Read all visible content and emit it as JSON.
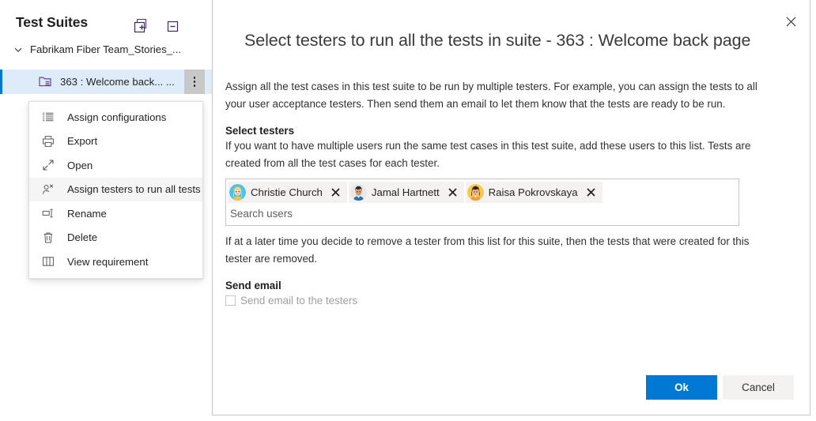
{
  "suites_panel": {
    "title": "Test Suites",
    "expand_all_icon": "expand-all-icon",
    "collapse_all_icon": "collapse-all-icon",
    "tree": [
      {
        "label": "Fabrikam Fiber Team_Stories_...",
        "icon": "chevron-down-icon",
        "level": 0,
        "selected": false
      },
      {
        "label": "363 : Welcome back... ...",
        "icon": "test-suite-folder-icon",
        "level": 1,
        "selected": true
      }
    ],
    "more_actions_icon": "more-actions-vertical-icon"
  },
  "context_menu": {
    "items": [
      {
        "label": "Assign configurations",
        "icon": "list-settings-icon",
        "hovered": false
      },
      {
        "label": "Export",
        "icon": "printer-icon",
        "hovered": false
      },
      {
        "label": "Open",
        "icon": "open-expand-icon",
        "hovered": false
      },
      {
        "label": "Assign testers to run all tests",
        "icon": "assign-user-icon",
        "hovered": true
      },
      {
        "label": "Rename",
        "icon": "rename-icon",
        "hovered": false
      },
      {
        "label": "Delete",
        "icon": "trash-icon",
        "hovered": false
      },
      {
        "label": "View requirement",
        "icon": "book-requirement-icon",
        "hovered": false
      }
    ]
  },
  "dialog": {
    "title": "Select testers to run all the tests in suite - 363 : Welcome back page",
    "close_icon": "close-icon",
    "intro_paragraph": "Assign all the test cases in this test suite to be run by multiple testers. For example, you can assign the tests to all your user acceptance testers. Then send them an email to let them know that the tests are ready to be run.",
    "select_testers": {
      "heading": "Select testers",
      "description": "If you want to have multiple users run the same test cases in this test suite, add these users to this list. Tests are created from all the test cases for each tester.",
      "chips": [
        {
          "name": "Christie Church",
          "avatar": "avatar-christie-church",
          "remove_icon": "remove-chip-icon"
        },
        {
          "name": "Jamal Hartnett",
          "avatar": "avatar-jamal-hartnett",
          "remove_icon": "remove-chip-icon"
        },
        {
          "name": "Raisa Pokrovskaya",
          "avatar": "avatar-raisa-pokrovskaya",
          "remove_icon": "remove-chip-icon"
        }
      ],
      "search_placeholder": "Search users",
      "search_value": "",
      "note": "If at a later time you decide to remove a tester from this list for this suite, then the tests that were created for this tester are removed."
    },
    "send_email": {
      "heading": "Send email",
      "checkbox_label": "Send email to the testers",
      "checked": false,
      "enabled": false
    },
    "buttons": {
      "ok": "Ok",
      "cancel": "Cancel"
    }
  },
  "colors": {
    "accent": "#0078d4",
    "selected_row_bg": "#deecf9",
    "chip_bg": "#f3f2f1",
    "disabled_text": "#a19f9d"
  }
}
